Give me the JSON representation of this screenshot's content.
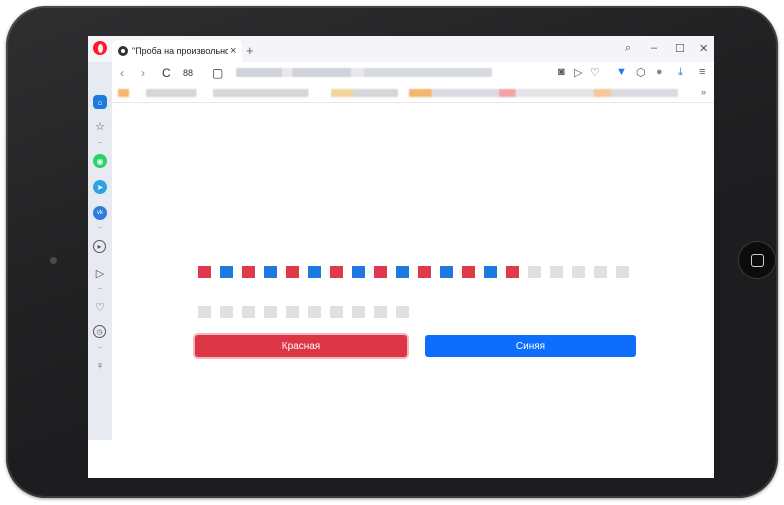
{
  "browser": {
    "tab_title": "\"Проба на произвольност",
    "tab_close": "×",
    "new_tab": "+",
    "window_controls": {
      "search": "⌕",
      "minimize": "–",
      "maximize": "☐",
      "close": "✕"
    },
    "nav": {
      "back": "‹",
      "forward": "›",
      "reload": "C",
      "speed_dial": "88",
      "page": "▢"
    },
    "bookmarks_more": "»"
  },
  "quiz": {
    "row1": [
      "red",
      "blue",
      "red",
      "blue",
      "red",
      "blue",
      "red",
      "blue",
      "red",
      "blue",
      "red",
      "blue",
      "red",
      "blue",
      "red",
      "empty",
      "empty",
      "empty",
      "empty",
      "empty"
    ],
    "row2": [
      "empty",
      "empty",
      "empty",
      "empty",
      "empty",
      "empty",
      "empty",
      "empty",
      "empty",
      "empty"
    ],
    "colors": {
      "red": "#e03a4a",
      "blue": "#1f7ae0",
      "empty": "#e0e0e0"
    },
    "buttons": {
      "red_label": "Красная",
      "blue_label": "Синяя"
    }
  },
  "sidebar": {
    "icons": [
      "home-icon",
      "star-icon",
      "whatsapp-icon",
      "telegram-icon",
      "vk-icon",
      "player-icon",
      "send-icon",
      "heart-icon",
      "history-icon",
      "tips-icon"
    ]
  }
}
